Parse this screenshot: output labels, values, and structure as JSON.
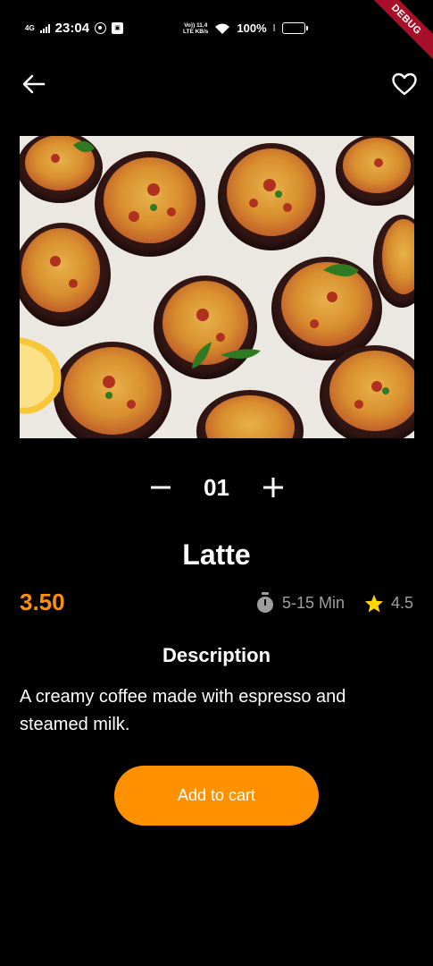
{
  "status_bar": {
    "network": "4G",
    "time": "23:04",
    "volte_top": "Vo)) 11.4",
    "volte_bottom": "LTE KB/s",
    "battery": "100%"
  },
  "debug_banner": "DEBUG",
  "app_bar": {
    "back_icon": "arrow-left-icon",
    "favorite_icon": "heart-outline-icon"
  },
  "product": {
    "image_alt": "stuffed mushrooms",
    "quantity": "01",
    "name": "Latte",
    "price": "3.50",
    "time": "5-15 Min",
    "rating": "4.5",
    "description_heading": "Description",
    "description": "A creamy coffee made with espresso and steamed milk."
  },
  "actions": {
    "add_to_cart": "Add to cart"
  },
  "colors": {
    "accent": "#ff9100",
    "star": "#ffd600",
    "background": "#000000",
    "muted_text": "#9e9e9e",
    "debug_ribbon": "#a8102a"
  }
}
